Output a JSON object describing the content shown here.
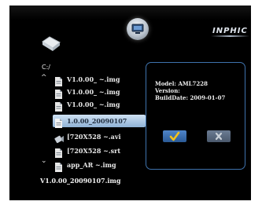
{
  "header": {
    "brand": "INPHIC",
    "tv_icon": "tv-icon"
  },
  "browser": {
    "folder_icon": "folder-icon",
    "drive": "C:/",
    "scroll_up": "^",
    "scroll_down": "⌄",
    "items": [
      {
        "label": "V1.0.00_ ~.img",
        "icon": "file-icon",
        "selected": false
      },
      {
        "label": "V1.0.00_ ~.img",
        "icon": "file-icon",
        "selected": false
      },
      {
        "label": "V1.0.00_ ~.img",
        "icon": "file-icon",
        "selected": false
      },
      {
        "label": "1.0.00_20090107",
        "icon": "file-icon",
        "selected": true
      },
      {
        "label": "[720X528 ~.avi",
        "icon": "video-icon",
        "selected": false
      },
      {
        "label": "[720X528 ~.srt",
        "icon": "file-icon",
        "selected": false
      },
      {
        "label": "app_AR ~.img",
        "icon": "file-icon",
        "selected": false
      }
    ],
    "current_file": "V1.0.00_20090107.img"
  },
  "dialog": {
    "model": "Model: AML7228",
    "version": "Version:",
    "build_date": "BuildDate: 2009-01-07",
    "ok_icon": "checkmark-icon",
    "cancel_icon": "x-icon"
  },
  "colors": {
    "background": "#000000",
    "dialog_border": "#3f73ad",
    "selection": "#a9c6e4",
    "ok_button": "#3d70b0",
    "cancel_button": "#5a6a80",
    "checkmark": "#f2c21a"
  }
}
